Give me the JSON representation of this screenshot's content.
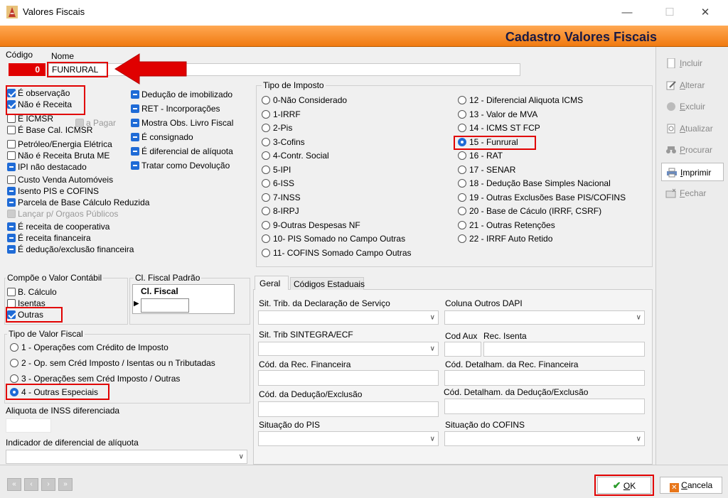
{
  "window": {
    "title": "Valores Fiscais",
    "minimize": "—",
    "maximize": "☐",
    "close": "✕"
  },
  "header": {
    "title": "Cadastro Valores Fiscais"
  },
  "record": {
    "codigo_label": "Código",
    "nome_label": "Nome",
    "codigo_value": "0",
    "nome_value": "FUNRURAL"
  },
  "flags_left": [
    {
      "label": "É observação",
      "state": "on"
    },
    {
      "label": "Não é Receita",
      "state": "on"
    },
    {
      "label": "É ICMSR",
      "state": "off"
    },
    {
      "label": "É Base Cal. ICMSR",
      "state": "off"
    },
    {
      "label": "Petróleo/Energia Elétrica",
      "state": "off"
    },
    {
      "label": "Não é Receita Bruta ME",
      "state": "off"
    },
    {
      "label": "IPI não destacado",
      "state": "ind"
    },
    {
      "label": "Custo Venda Automóveis",
      "state": "off"
    },
    {
      "label": "Isento PIS e COFINS",
      "state": "ind"
    },
    {
      "label": "Parcela de Base Cálculo Reduzida",
      "state": "ind"
    },
    {
      "label": "Lançar p/ Orgaos Públicos",
      "state": "off",
      "disabled": true
    },
    {
      "label": "É receita de cooperativa",
      "state": "ind"
    },
    {
      "label": "É receita financeira",
      "state": "ind"
    },
    {
      "label": "É dedução/exclusão financeira",
      "state": "ind"
    }
  ],
  "a_pagar": "a Pagar",
  "flags_mid": [
    {
      "label": "Dedução de imobilizado"
    },
    {
      "label": "RET - Incorporações"
    },
    {
      "label": "Mostra Obs. Livro Fiscal"
    },
    {
      "label": "É consignado"
    },
    {
      "label": "É diferencial de alíquota"
    },
    {
      "label": "Tratar como Devolução"
    }
  ],
  "tipo_imposto": {
    "title": "Tipo de Imposto",
    "col1": [
      "0-Não Considerado",
      "1-IRRF",
      "2-Pis",
      "3-Cofins",
      "4-Contr. Social",
      "5-IPI",
      "6-ISS",
      "7-INSS",
      "8-IRPJ",
      "9-Outras Despesas NF",
      "10- PIS Somado no Campo Outras",
      "11- COFINS Somado Campo Outras"
    ],
    "col2": [
      "12 - Diferencial Aliquota ICMS",
      "13 - Valor de MVA",
      "14 - ICMS ST FCP",
      "15 - Funrural",
      "16 - RAT",
      "17 - SENAR",
      "18 - Dedução Base Simples Nacional",
      "19 - Outras Exclusões Base PIS/COFINS",
      "20 - Base de Cáculo (IRRF, CSRF)",
      "21 - Outras Retenções",
      "22 - IRRF Auto Retido"
    ],
    "selected": "15 - Funrural"
  },
  "compoe": {
    "title": "Compõe o Valor Contábil",
    "items": [
      {
        "label": "B. Cálculo",
        "state": "off"
      },
      {
        "label": "Isentas",
        "state": "off"
      },
      {
        "label": "Outras",
        "state": "on"
      }
    ]
  },
  "cl_fiscal": {
    "title": "Cl. Fiscal Padrão",
    "col_header": "Cl. Fiscal"
  },
  "tipo_valor": {
    "title": "Tipo de Valor Fiscal",
    "items": [
      "1 - Operações com Crédito de Imposto",
      "2 - Op. sem Créd Imposto / Isentas ou n Tributadas",
      "3 - Operações sem Créd Imposto / Outras",
      "4 - Outras Especiais"
    ],
    "selected": "4 - Outras Especiais"
  },
  "aliquota_inss": {
    "label": "Aliquota de INSS diferenciada"
  },
  "indicador": {
    "label": "Indicador de diferencial de alíquota"
  },
  "tabs": {
    "geral": "Geral",
    "codigos": "Códigos Estaduais"
  },
  "geral": {
    "sit_trib": "Sit. Trib. da Declaração de Serviço",
    "coluna_dapi": "Coluna Outros DAPI",
    "sintegra": "Sit. Trib SINTEGRA/ECF",
    "cod_aux": "Cod Aux",
    "rec_isenta": "Rec. Isenta",
    "cod_rec_fin": "Cód. da Rec. Financeira",
    "cod_det_rec_fin": "Cód. Detalham. da Rec. Financeira",
    "cod_ded": "Cód. da Dedução/Exclusão",
    "cod_det_ded": "Cód. Detalham. da Dedução/Exclusão",
    "sit_pis": "Situação do PIS",
    "sit_cofins": "Situação do COFINS"
  },
  "side_buttons": [
    {
      "pre": "",
      "u": "I",
      "post": "ncluir",
      "icon": "doc-icon"
    },
    {
      "pre": "",
      "u": "A",
      "post": "lterar",
      "icon": "edit-icon"
    },
    {
      "pre": "",
      "u": "E",
      "post": "xcluir",
      "icon": "delete-icon"
    },
    {
      "pre": "",
      "u": "A",
      "post": "tualizar",
      "icon": "refresh-icon"
    },
    {
      "pre": "",
      "u": "P",
      "post": "rocurar",
      "icon": "binoculars-icon"
    },
    {
      "pre": "",
      "u": "I",
      "post": "mprimir",
      "icon": "printer-icon"
    },
    {
      "pre": "",
      "u": "F",
      "post": "echar",
      "icon": "close-folder-icon"
    }
  ],
  "footer": {
    "ok_u": "O",
    "ok_post": "K",
    "cancel_u": "C",
    "cancel_post": "ancela",
    "nav": [
      "«",
      "‹",
      "›",
      "»"
    ]
  }
}
